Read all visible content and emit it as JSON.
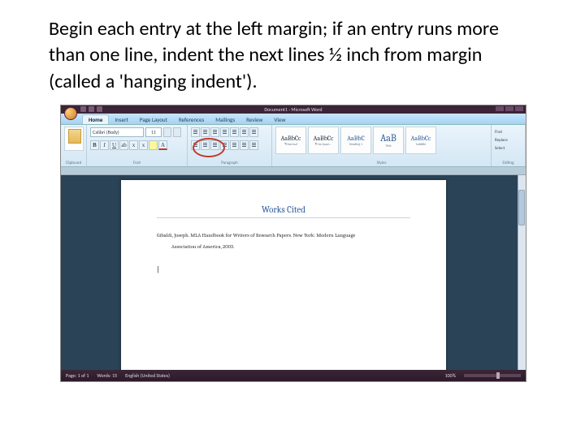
{
  "instruction": "Begin each entry at the left margin; if an entry runs more than one line, indent the next lines ½ inch from margin (called a 'hanging indent').",
  "titlebar": {
    "title": "Document1 - Microsoft Word"
  },
  "tabs": {
    "items": [
      "Home",
      "Insert",
      "Page Layout",
      "References",
      "Mailings",
      "Review",
      "View"
    ],
    "active": "Home"
  },
  "ribbon": {
    "clipboard": {
      "label": "Clipboard"
    },
    "font": {
      "name": "Calibri (Body)",
      "size": "11",
      "label": "Font"
    },
    "paragraph": {
      "label": "Paragraph"
    },
    "styles": {
      "label": "Styles",
      "items": [
        {
          "sample": "AaBbCc",
          "name": "¶ Normal"
        },
        {
          "sample": "AaBbCc",
          "name": "¶ No Spaci..."
        },
        {
          "sample": "AaBbC",
          "name": "Heading 1"
        },
        {
          "sample": "AaB",
          "name": "Title"
        },
        {
          "sample": "AaBbCc",
          "name": "Subtitle"
        }
      ]
    },
    "editing": {
      "label": "Editing",
      "find": "Find",
      "replace": "Replace",
      "select": "Select"
    }
  },
  "document": {
    "heading": "Works Cited",
    "citation_line1": "Gibaldi, Joseph. MLA Handbook for Writers of Research Papers. New York: Modern Language",
    "citation_line2": "Association of America, 2003.",
    "cursor": "|"
  },
  "status": {
    "page": "Page: 1 of 1",
    "words": "Words: 15",
    "language": "English (United States)",
    "zoom": "100%"
  }
}
